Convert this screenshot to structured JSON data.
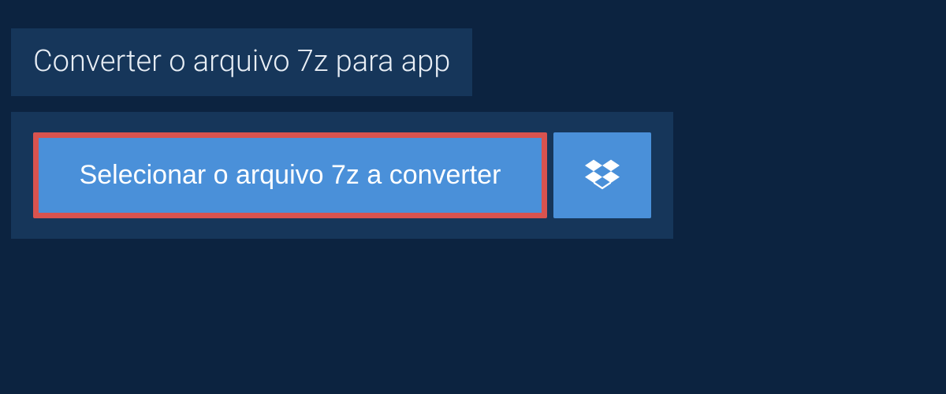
{
  "header": {
    "title": "Converter o arquivo 7z para app"
  },
  "upload": {
    "select_button_label": "Selecionar o arquivo 7z a converter",
    "dropbox_icon": "dropbox-icon"
  },
  "colors": {
    "background": "#0c2340",
    "panel": "#16365a",
    "button": "#4a90d9",
    "highlight_border": "#d9534f",
    "text_light": "#ffffff"
  }
}
